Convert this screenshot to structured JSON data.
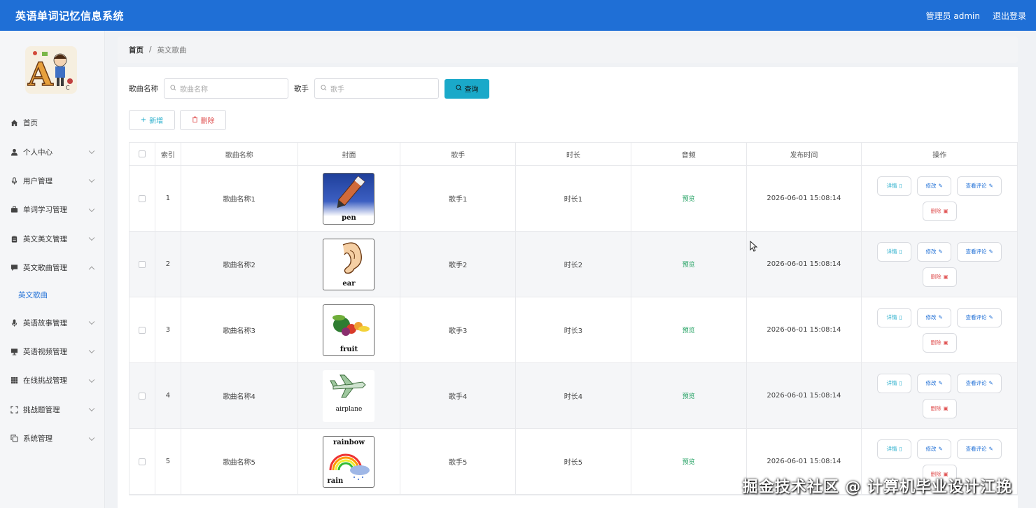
{
  "header": {
    "app_title": "英语单词记忆信息系统",
    "user_label": "管理员 admin",
    "logout_label": "退出登录"
  },
  "sidebar": {
    "items": [
      {
        "label": "首页",
        "icon": "home-icon",
        "chevron": false
      },
      {
        "label": "个人中心",
        "icon": "user-icon",
        "chevron": true
      },
      {
        "label": "用户管理",
        "icon": "mic-icon",
        "chevron": true
      },
      {
        "label": "单词学习管理",
        "icon": "briefcase-icon",
        "chevron": true
      },
      {
        "label": "英文美文管理",
        "icon": "clipboard-icon",
        "chevron": true
      },
      {
        "label": "英文歌曲管理",
        "icon": "chat-icon",
        "chevron": true,
        "expanded": true
      },
      {
        "label": "英语故事管理",
        "icon": "mic-icon",
        "chevron": true
      },
      {
        "label": "英语视频管理",
        "icon": "screen-icon",
        "chevron": true
      },
      {
        "label": "在线挑战管理",
        "icon": "grid-icon",
        "chevron": true
      },
      {
        "label": "挑战题管理",
        "icon": "frame-icon",
        "chevron": true
      },
      {
        "label": "系统管理",
        "icon": "copy-icon",
        "chevron": true
      }
    ],
    "sub_item": "英文歌曲"
  },
  "breadcrumb": {
    "home": "首页",
    "separator": "/",
    "current": "英文歌曲"
  },
  "search": {
    "name_label": "歌曲名称",
    "name_placeholder": "歌曲名称",
    "singer_label": "歌手",
    "singer_placeholder": "歌手",
    "query_label": "查询"
  },
  "actions": {
    "add_label": "新增",
    "delete_label": "删除"
  },
  "table": {
    "headers": [
      "索引",
      "歌曲名称",
      "封面",
      "歌手",
      "时长",
      "音频",
      "发布时间",
      "操作"
    ],
    "rows": [
      {
        "index": "1",
        "name": "歌曲名称1",
        "cover": "pen",
        "singer": "歌手1",
        "duration": "时长1",
        "audio": "预览",
        "time": "2026-06-01 15:08:14"
      },
      {
        "index": "2",
        "name": "歌曲名称2",
        "cover": "ear",
        "singer": "歌手2",
        "duration": "时长2",
        "audio": "预览",
        "time": "2026-06-01 15:08:14"
      },
      {
        "index": "3",
        "name": "歌曲名称3",
        "cover": "fruit",
        "singer": "歌手3",
        "duration": "时长3",
        "audio": "预览",
        "time": "2026-06-01 15:08:14"
      },
      {
        "index": "4",
        "name": "歌曲名称4",
        "cover": "airplane",
        "singer": "歌手4",
        "duration": "时长4",
        "audio": "预览",
        "time": "2026-06-01 15:08:14"
      },
      {
        "index": "5",
        "name": "歌曲名称5",
        "cover": "rainbow",
        "singer": "歌手5",
        "duration": "时长5",
        "audio": "预览",
        "time": "2026-06-01 15:08:14"
      }
    ],
    "ops": {
      "detail": "详情",
      "edit": "修改",
      "comment": "查看评论",
      "delete": "删除"
    }
  },
  "cover_extra": {
    "rainbow_bottom": "rain"
  },
  "watermark": "掘金技术社区 @ 计算机毕业设计江挽",
  "colors": {
    "header_bg": "#1f6fd6",
    "accent": "#1aa9c9",
    "danger": "#e05555",
    "audio_link": "#20a060"
  }
}
